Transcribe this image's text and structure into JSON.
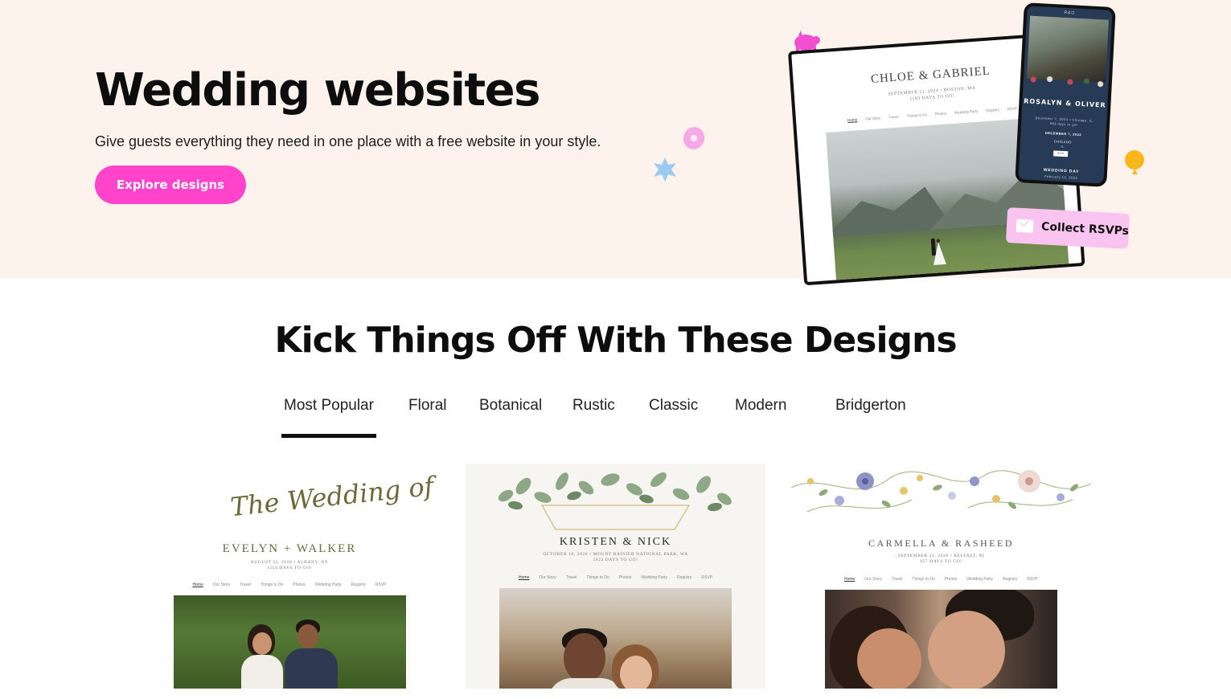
{
  "hero": {
    "title": "Wedding websites",
    "subtitle": "Give guests everything they need in one place with a free website in your style.",
    "cta_label": "Explore designs",
    "background": "#fdf3ec",
    "accent": "#ff44cb"
  },
  "laptop_preview": {
    "names": "CHLOE & GABRIEL",
    "date_line": "SEPTEMBER 21, 2024 • BOSTON, MA",
    "countdown": "1183 DAYS TO GO!",
    "nav": [
      "Home",
      "Our Story",
      "Travel",
      "Things to Do",
      "Photos",
      "Wedding Party",
      "Registry",
      "RSVP"
    ]
  },
  "phone_preview": {
    "top": "R&O",
    "names": "ROSALYN & OLIVER",
    "line1": "December 7, 2024 • Chicago, IL",
    "line2": "993 days to go!",
    "date": "DECEMBER 7, 2024",
    "city": "CHICAGO",
    "state": "IL",
    "btn": "RSVP",
    "wedding_day": "WEDDING DAY",
    "wedding_day_sub": "February 12, 2024"
  },
  "rsvp_badge": {
    "label": "Collect RSVPs"
  },
  "designs": {
    "title": "Kick Things Off With These Designs",
    "tabs": [
      "Most Popular",
      "Floral",
      "Botanical",
      "Rustic",
      "Classic",
      "Modern",
      "Bridgerton"
    ],
    "active_tab": "Most Popular",
    "cards": [
      {
        "script": "The Wedding of",
        "names": "EVELYN + WALKER",
        "date_line": "AUGUST 22, 2026 • ALBANY, NY",
        "countdown": "1254 DAYS TO GO!",
        "nav": [
          "Home",
          "Our Story",
          "Travel",
          "Things to Do",
          "Photos",
          "Wedding Party",
          "Registry",
          "RSVP"
        ],
        "name_color": "#6b6a3a"
      },
      {
        "names": "KRISTEN & NICK",
        "date_line": "OCTOBER 18, 2026 • MOUNT RAINIER NATIONAL PARK, WA",
        "countdown": "1023 DAYS TO GO!",
        "nav": [
          "Home",
          "Our Story",
          "Travel",
          "Things to Do",
          "Photos",
          "Wedding Party",
          "Registry",
          "RSVP"
        ],
        "name_color": "#2a2a2a"
      },
      {
        "names": "CARMELLA & RASHEED",
        "date_line": "SEPTEMBER 12, 2026 • BELFAST, NI",
        "countdown": "957 DAYS TO GO!",
        "nav": [
          "Home",
          "Our Story",
          "Travel",
          "Things to Do",
          "Photos",
          "Wedding Party",
          "Registry",
          "RSVP"
        ],
        "name_color": "#555555"
      }
    ]
  }
}
